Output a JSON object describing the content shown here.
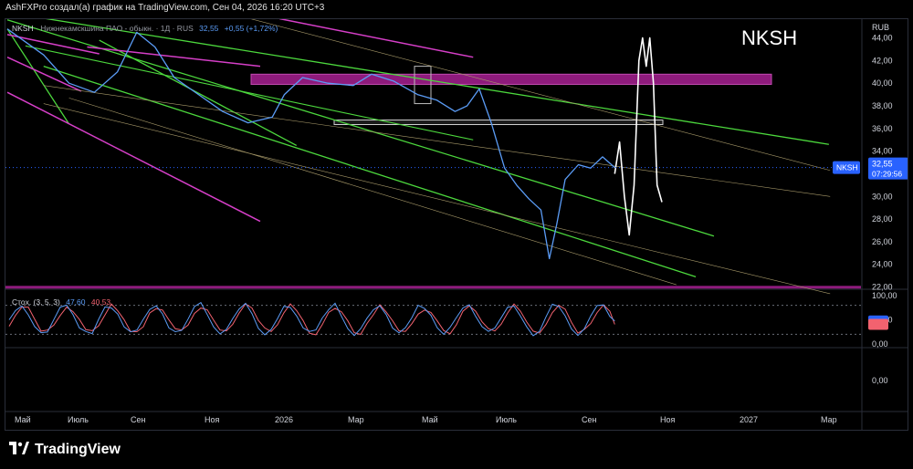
{
  "header": {
    "caption": "AshFXPro создал(а) график на TradingView.com, Сен 04, 2026 16:20 UTC+3"
  },
  "legend": {
    "symbol": "NKSH",
    "description": "· Нижнекамскшина ПАО - обыкн. · 1Д · RUS",
    "last": "32,55",
    "change": "+0,55 (+1,72%)"
  },
  "annotation": "NKSH",
  "price_axis": {
    "currency": "RUB",
    "ticks": [
      "44,00",
      "42,00",
      "40,00",
      "38,00",
      "36,00",
      "34,00",
      "30,00",
      "28,00",
      "26,00",
      "24,00",
      "22,00"
    ],
    "badge_symbol": "NKSH",
    "badge_price": "32,55",
    "badge_timer": "07:29:56"
  },
  "stochastic": {
    "label": "Стох. (3, 5, 3)",
    "k_value": "47,60",
    "d_value": "40,53",
    "ticks": [
      "100,00",
      "50,00",
      "0,00"
    ],
    "k_color": "#5b9cf6",
    "d_color": "#f2626f"
  },
  "empty_pane": {
    "ticks": [
      "0,00"
    ]
  },
  "time_axis": {
    "labels": [
      "Май",
      "Июль",
      "Сен",
      "Ноя",
      "2026",
      "Мар",
      "Май",
      "Июль",
      "Сен",
      "Ноя",
      "2027",
      "Мар"
    ]
  },
  "footer": {
    "brand": "TradingView",
    "logo_icon": "tradingview-logo-icon"
  },
  "colors": {
    "price_line": "#5b9cf6",
    "trend_green": "#4cd83d",
    "trend_magenta": "#d63fc8",
    "zone_fill": "#8e1b7c",
    "projection": "#ffffff",
    "guide": "#a89a6a"
  },
  "chart_data": {
    "type": "line",
    "title": "NKSH",
    "y_unit": "RUB",
    "ylim": [
      21.8,
      45.5
    ],
    "x_label_positions_note": "",
    "series": [
      {
        "name": "NKSH",
        "x": [
          "2025-04-20",
          "2025-05-20",
          "2025-06-10",
          "2025-07-01",
          "2025-07-20",
          "2025-08-05",
          "2025-08-20",
          "2025-09-05",
          "2025-09-25",
          "2025-10-15",
          "2025-11-05",
          "2025-11-25",
          "2025-12-05",
          "2025-12-20",
          "2026-01-10",
          "2026-01-31",
          "2026-02-15",
          "2026-03-05",
          "2026-03-25",
          "2026-04-10",
          "2026-04-25",
          "2026-05-05",
          "2026-05-15",
          "2026-05-25",
          "2026-06-05",
          "2026-06-15",
          "2026-06-25",
          "2026-07-05",
          "2026-07-12",
          "2026-07-18",
          "2026-07-25",
          "2026-08-05",
          "2026-08-15",
          "2026-08-25",
          "2026-09-04"
        ],
        "values": [
          44.8,
          42.5,
          40.0,
          39.2,
          41.0,
          44.5,
          43.2,
          40.5,
          39.0,
          37.5,
          36.5,
          37.0,
          39.0,
          40.5,
          40.0,
          39.8,
          40.8,
          40.2,
          39.0,
          38.5,
          37.5,
          38.0,
          39.5,
          36.5,
          32.5,
          31.0,
          29.8,
          28.8,
          24.5,
          27.5,
          31.5,
          32.8,
          32.5,
          33.5,
          32.55
        ]
      }
    ],
    "stochastic": {
      "k": 47.6,
      "d": 40.53,
      "ylim": [
        0,
        100
      ]
    }
  }
}
